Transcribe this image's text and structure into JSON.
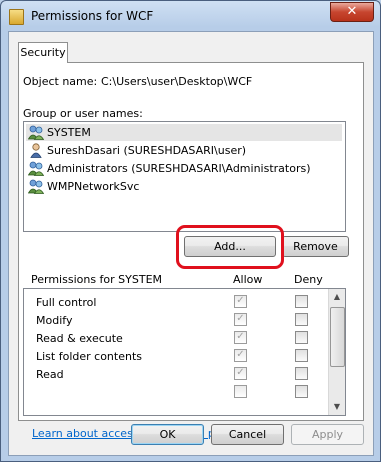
{
  "window": {
    "title": "Permissions for WCF",
    "close_glyph": "✕"
  },
  "tabs": [
    {
      "label": "Security"
    }
  ],
  "object": {
    "label": "Object name:",
    "value": "C:\\Users\\user\\Desktop\\WCF"
  },
  "users": {
    "label": "Group or user names:",
    "items": [
      {
        "name": "SYSTEM",
        "icon": "group-users-icon",
        "selected": true
      },
      {
        "name": "SureshDasari (SURESHDASARI\\user)",
        "icon": "single-user-icon",
        "selected": false
      },
      {
        "name": "Administrators (SURESHDASARI\\Administrators)",
        "icon": "group-users-icon",
        "selected": false
      },
      {
        "name": "WMPNetworkSvc",
        "icon": "group-users-icon",
        "selected": false
      }
    ]
  },
  "buttons": {
    "add": "Add...",
    "remove": "Remove",
    "ok": "OK",
    "cancel": "Cancel",
    "apply": "Apply"
  },
  "permissions": {
    "label": "Permissions for SYSTEM",
    "allow_header": "Allow",
    "deny_header": "Deny",
    "rows": [
      {
        "name": "Full control",
        "allow": true,
        "deny": false
      },
      {
        "name": "Modify",
        "allow": true,
        "deny": false
      },
      {
        "name": "Read & execute",
        "allow": true,
        "deny": false
      },
      {
        "name": "List folder contents",
        "allow": true,
        "deny": false
      },
      {
        "name": "Read",
        "allow": true,
        "deny": false
      }
    ]
  },
  "link": {
    "text": "Learn about access control and permissions"
  },
  "colors": {
    "highlight": "#e0101d",
    "link": "#0066cc"
  }
}
